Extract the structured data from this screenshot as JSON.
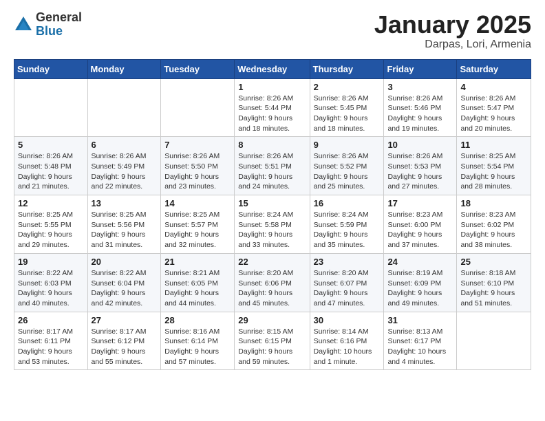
{
  "header": {
    "logo_general": "General",
    "logo_blue": "Blue",
    "month_title": "January 2025",
    "location": "Darpas, Lori, Armenia"
  },
  "weekdays": [
    "Sunday",
    "Monday",
    "Tuesday",
    "Wednesday",
    "Thursday",
    "Friday",
    "Saturday"
  ],
  "weeks": [
    [
      {
        "day": "",
        "info": ""
      },
      {
        "day": "",
        "info": ""
      },
      {
        "day": "",
        "info": ""
      },
      {
        "day": "1",
        "info": "Sunrise: 8:26 AM\nSunset: 5:44 PM\nDaylight: 9 hours\nand 18 minutes."
      },
      {
        "day": "2",
        "info": "Sunrise: 8:26 AM\nSunset: 5:45 PM\nDaylight: 9 hours\nand 18 minutes."
      },
      {
        "day": "3",
        "info": "Sunrise: 8:26 AM\nSunset: 5:46 PM\nDaylight: 9 hours\nand 19 minutes."
      },
      {
        "day": "4",
        "info": "Sunrise: 8:26 AM\nSunset: 5:47 PM\nDaylight: 9 hours\nand 20 minutes."
      }
    ],
    [
      {
        "day": "5",
        "info": "Sunrise: 8:26 AM\nSunset: 5:48 PM\nDaylight: 9 hours\nand 21 minutes."
      },
      {
        "day": "6",
        "info": "Sunrise: 8:26 AM\nSunset: 5:49 PM\nDaylight: 9 hours\nand 22 minutes."
      },
      {
        "day": "7",
        "info": "Sunrise: 8:26 AM\nSunset: 5:50 PM\nDaylight: 9 hours\nand 23 minutes."
      },
      {
        "day": "8",
        "info": "Sunrise: 8:26 AM\nSunset: 5:51 PM\nDaylight: 9 hours\nand 24 minutes."
      },
      {
        "day": "9",
        "info": "Sunrise: 8:26 AM\nSunset: 5:52 PM\nDaylight: 9 hours\nand 25 minutes."
      },
      {
        "day": "10",
        "info": "Sunrise: 8:26 AM\nSunset: 5:53 PM\nDaylight: 9 hours\nand 27 minutes."
      },
      {
        "day": "11",
        "info": "Sunrise: 8:25 AM\nSunset: 5:54 PM\nDaylight: 9 hours\nand 28 minutes."
      }
    ],
    [
      {
        "day": "12",
        "info": "Sunrise: 8:25 AM\nSunset: 5:55 PM\nDaylight: 9 hours\nand 29 minutes."
      },
      {
        "day": "13",
        "info": "Sunrise: 8:25 AM\nSunset: 5:56 PM\nDaylight: 9 hours\nand 31 minutes."
      },
      {
        "day": "14",
        "info": "Sunrise: 8:25 AM\nSunset: 5:57 PM\nDaylight: 9 hours\nand 32 minutes."
      },
      {
        "day": "15",
        "info": "Sunrise: 8:24 AM\nSunset: 5:58 PM\nDaylight: 9 hours\nand 33 minutes."
      },
      {
        "day": "16",
        "info": "Sunrise: 8:24 AM\nSunset: 5:59 PM\nDaylight: 9 hours\nand 35 minutes."
      },
      {
        "day": "17",
        "info": "Sunrise: 8:23 AM\nSunset: 6:00 PM\nDaylight: 9 hours\nand 37 minutes."
      },
      {
        "day": "18",
        "info": "Sunrise: 8:23 AM\nSunset: 6:02 PM\nDaylight: 9 hours\nand 38 minutes."
      }
    ],
    [
      {
        "day": "19",
        "info": "Sunrise: 8:22 AM\nSunset: 6:03 PM\nDaylight: 9 hours\nand 40 minutes."
      },
      {
        "day": "20",
        "info": "Sunrise: 8:22 AM\nSunset: 6:04 PM\nDaylight: 9 hours\nand 42 minutes."
      },
      {
        "day": "21",
        "info": "Sunrise: 8:21 AM\nSunset: 6:05 PM\nDaylight: 9 hours\nand 44 minutes."
      },
      {
        "day": "22",
        "info": "Sunrise: 8:20 AM\nSunset: 6:06 PM\nDaylight: 9 hours\nand 45 minutes."
      },
      {
        "day": "23",
        "info": "Sunrise: 8:20 AM\nSunset: 6:07 PM\nDaylight: 9 hours\nand 47 minutes."
      },
      {
        "day": "24",
        "info": "Sunrise: 8:19 AM\nSunset: 6:09 PM\nDaylight: 9 hours\nand 49 minutes."
      },
      {
        "day": "25",
        "info": "Sunrise: 8:18 AM\nSunset: 6:10 PM\nDaylight: 9 hours\nand 51 minutes."
      }
    ],
    [
      {
        "day": "26",
        "info": "Sunrise: 8:17 AM\nSunset: 6:11 PM\nDaylight: 9 hours\nand 53 minutes."
      },
      {
        "day": "27",
        "info": "Sunrise: 8:17 AM\nSunset: 6:12 PM\nDaylight: 9 hours\nand 55 minutes."
      },
      {
        "day": "28",
        "info": "Sunrise: 8:16 AM\nSunset: 6:14 PM\nDaylight: 9 hours\nand 57 minutes."
      },
      {
        "day": "29",
        "info": "Sunrise: 8:15 AM\nSunset: 6:15 PM\nDaylight: 9 hours\nand 59 minutes."
      },
      {
        "day": "30",
        "info": "Sunrise: 8:14 AM\nSunset: 6:16 PM\nDaylight: 10 hours\nand 1 minute."
      },
      {
        "day": "31",
        "info": "Sunrise: 8:13 AM\nSunset: 6:17 PM\nDaylight: 10 hours\nand 4 minutes."
      },
      {
        "day": "",
        "info": ""
      }
    ]
  ]
}
